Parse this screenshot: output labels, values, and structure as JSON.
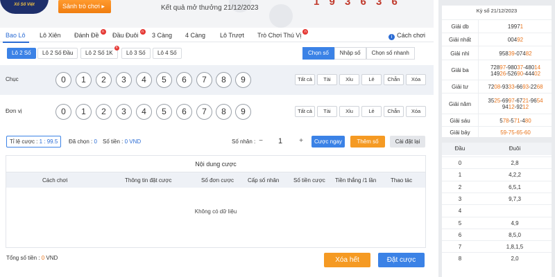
{
  "header": {
    "logo_text": "Xổ Số Việt",
    "hall_button": "Sảnh trò chơi ▸",
    "result_label": "Kết quả mở thưởng 21/12/2023",
    "drawn_digits": "1 9 3 6 3 6"
  },
  "tabs": [
    {
      "label": "Bao Lô",
      "active": true,
      "badge": false
    },
    {
      "label": "Lô Xiên",
      "active": false,
      "badge": false
    },
    {
      "label": "Đánh Đề",
      "active": false,
      "badge": true
    },
    {
      "label": "Đầu Đuôi",
      "active": false,
      "badge": true
    },
    {
      "label": "3 Càng",
      "active": false,
      "badge": false
    },
    {
      "label": "4 Càng",
      "active": false,
      "badge": false
    },
    {
      "label": "Lô Trượt",
      "active": false,
      "badge": false
    },
    {
      "label": "Trò Chơi Thú Vị",
      "active": false,
      "badge": true
    }
  ],
  "rules_link": "Cách chơi",
  "badge_text": "n",
  "subtabs": [
    {
      "label": "Lô 2 Số",
      "active": true,
      "badge": false
    },
    {
      "label": "Lô 2 Số Đầu",
      "active": false,
      "badge": false
    },
    {
      "label": "Lô 2 Số 1K",
      "active": false,
      "badge": true
    },
    {
      "label": "Lô 3 Số",
      "active": false,
      "badge": false
    },
    {
      "label": "Lô 4 Số",
      "active": false,
      "badge": false
    }
  ],
  "modes": [
    {
      "label": "Chọn số",
      "active": true
    },
    {
      "label": "Nhập số",
      "active": false
    },
    {
      "label": "Chọn số nhanh",
      "active": false
    }
  ],
  "rows": [
    {
      "label": "Chục"
    },
    {
      "label": "Đơn vị"
    }
  ],
  "numbers": [
    "0",
    "1",
    "2",
    "3",
    "4",
    "5",
    "6",
    "7",
    "8",
    "9"
  ],
  "quick_buttons": [
    "Tất cả",
    "Tài",
    "Xỉu",
    "Lẻ",
    "Chẵn",
    "Xóa"
  ],
  "bet": {
    "rate_label": "Tỉ lệ cược : ",
    "rate_value": "1 : 99.5",
    "selected_label": "Đã chọn : ",
    "selected_value": "0",
    "amount_label": "Số tiền : ",
    "amount_value": "0 VND",
    "multiplier_label": "Số nhân :",
    "multiplier_value": "1",
    "bet_now": "Cược ngay",
    "add_number": "Thêm số",
    "reset": "Cài đặt lại"
  },
  "content": {
    "title": "Nội dung cược",
    "columns": [
      "Cách chơi",
      "Thông tin đặt cược",
      "Số đơn cược",
      "Cấp số nhân",
      "Số tiền cược",
      "Tiền thắng /1 lần",
      "Thao tác"
    ],
    "empty_text": "Không có dữ liệu"
  },
  "footer": {
    "total_label": "Tổng số tiền : ",
    "total_value": "0",
    "total_unit": " VND",
    "clear_all": "Xóa hết",
    "place_bet": "Đặt cược"
  },
  "results": {
    "date_label": "Kỳ số 21/12/2023",
    "prizes": [
      {
        "name": "Giải db",
        "lines": [
          [
            [
              "1997",
              false
            ],
            [
              "1",
              true
            ]
          ]
        ]
      },
      {
        "name": "Giải nhất",
        "lines": [
          [
            [
              "004",
              false
            ],
            [
              "92",
              true
            ]
          ]
        ]
      },
      {
        "name": "Giải nhì",
        "lines": [
          [
            [
              "958",
              false
            ],
            [
              "39",
              true
            ],
            [
              "-074",
              false
            ],
            [
              "82",
              true
            ]
          ]
        ]
      },
      {
        "name": "Giải ba",
        "lines": [
          [
            [
              "728",
              false
            ],
            [
              "97",
              true
            ],
            [
              "-980",
              false
            ],
            [
              "37",
              true
            ],
            [
              "-480",
              false
            ],
            [
              "14",
              true
            ]
          ],
          [
            [
              "149",
              false
            ],
            [
              "26",
              true
            ],
            [
              "-526",
              false
            ],
            [
              "90",
              true
            ],
            [
              "-444",
              false
            ],
            [
              "02",
              true
            ]
          ]
        ]
      },
      {
        "name": "Giải tư",
        "lines": [
          [
            [
              "72",
              false
            ],
            [
              "08",
              true
            ],
            [
              "-93",
              false
            ],
            [
              "33",
              true
            ],
            [
              "-66",
              false
            ],
            [
              "93",
              true
            ],
            [
              "-22",
              false
            ],
            [
              "68",
              true
            ]
          ]
        ]
      },
      {
        "name": "Giải năm",
        "lines": [
          [
            [
              "35",
              false
            ],
            [
              "25",
              true
            ],
            [
              "-69",
              false
            ],
            [
              "97",
              true
            ],
            [
              "-67",
              false
            ],
            [
              "21",
              true
            ],
            [
              "-96",
              false
            ],
            [
              "54",
              true
            ]
          ],
          [
            [
              "94",
              false
            ],
            [
              "12",
              true
            ],
            [
              "-92",
              false
            ],
            [
              "12",
              true
            ]
          ]
        ]
      },
      {
        "name": "Giải sáu",
        "lines": [
          [
            [
              "5",
              false
            ],
            [
              "78",
              true
            ],
            [
              "-5",
              false
            ],
            [
              "71",
              true
            ],
            [
              "-4",
              false
            ],
            [
              "80",
              true
            ]
          ]
        ]
      },
      {
        "name": "Giải bảy",
        "lines": [
          [
            [
              "59-75-65-60",
              true
            ]
          ]
        ]
      }
    ],
    "table_headers": [
      "Đầu",
      "Đuôi"
    ],
    "table_rows": [
      [
        "0",
        "2,8"
      ],
      [
        "1",
        "4,2,2"
      ],
      [
        "2",
        "6,5,1"
      ],
      [
        "3",
        "9,7,3"
      ],
      [
        "4",
        ""
      ],
      [
        "5",
        "4,9"
      ],
      [
        "6",
        "8,5,0"
      ],
      [
        "7",
        "1,8,1,5"
      ],
      [
        "8",
        "2,0"
      ]
    ]
  },
  "colors": {
    "accent_blue": "#3b82e6",
    "accent_orange": "#f59a23",
    "highlight_orange": "#e8731a",
    "badge_red": "#e53935"
  }
}
